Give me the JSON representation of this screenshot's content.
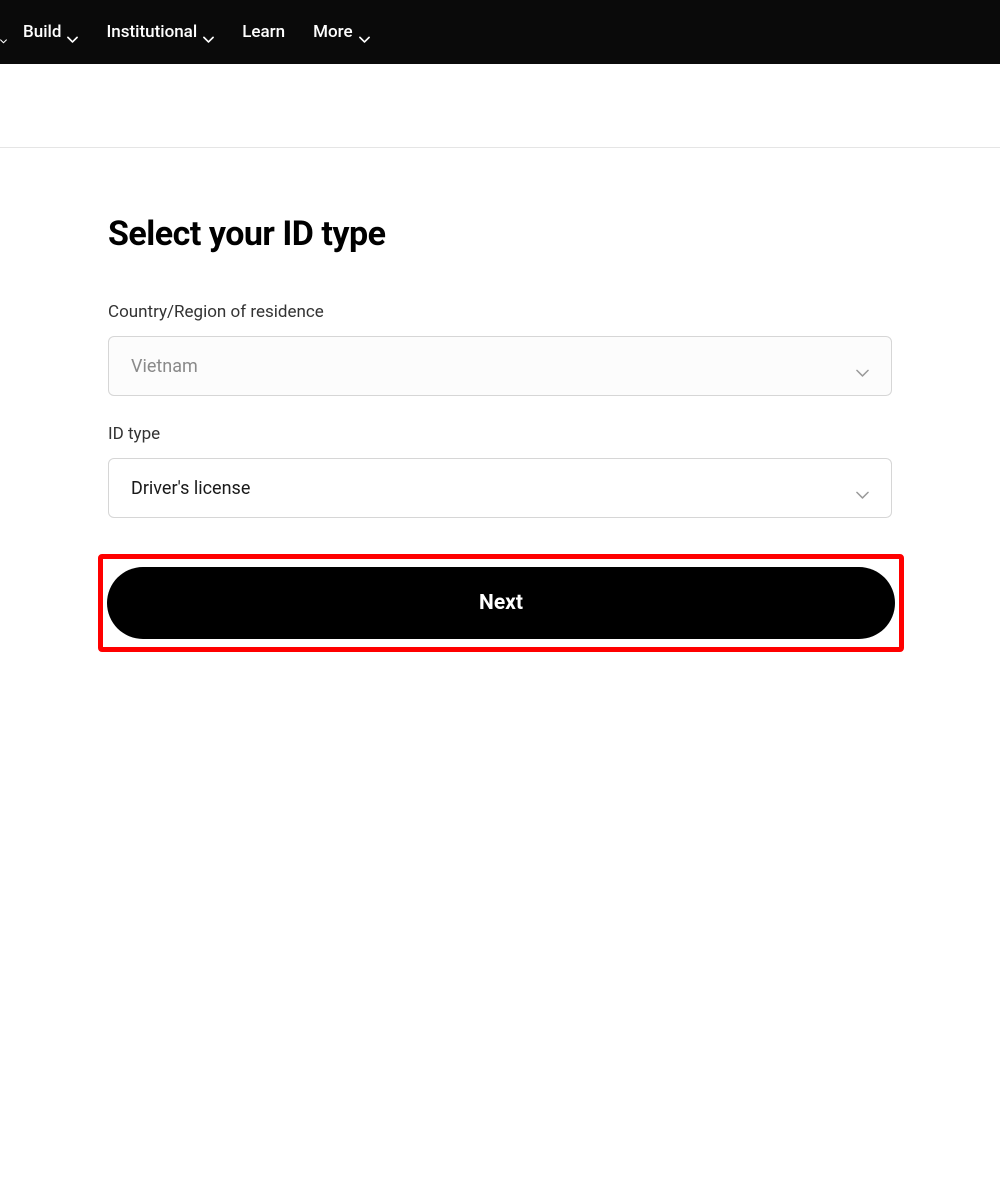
{
  "nav": {
    "items": [
      {
        "label": "Build",
        "hasDropdown": true
      },
      {
        "label": "Institutional",
        "hasDropdown": true
      },
      {
        "label": "Learn",
        "hasDropdown": false
      },
      {
        "label": "More",
        "hasDropdown": true
      }
    ]
  },
  "page": {
    "title": "Select your ID type"
  },
  "form": {
    "country": {
      "label": "Country/Region of residence",
      "value": "Vietnam"
    },
    "idType": {
      "label": "ID type",
      "value": "Driver's license"
    },
    "nextButton": "Next"
  }
}
